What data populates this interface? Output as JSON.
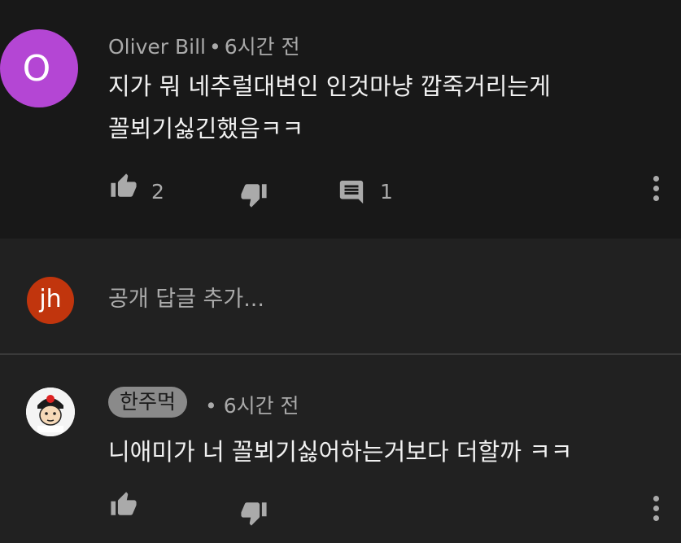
{
  "comments": [
    {
      "avatar_letter": "O",
      "avatar_color": "#b446d4",
      "author": "Oliver Bill",
      "separator": "•",
      "time": "6시간 전",
      "text_lines": [
        "지가 뭐 네추럴대변인 인것마냥 깝죽거리는게",
        "꼴뵈기싫긴했음ㅋㅋ"
      ],
      "like_count": "2",
      "reply_count": "1"
    },
    {
      "avatar_label": "한주먹TV",
      "author": "한주먹",
      "separator": "•",
      "time": "6시간 전",
      "text": "니애미가 너 꼴뵈기싫어하는거보다 더할까 ㅋㅋ"
    }
  ],
  "reply_box": {
    "avatar_text": "jh",
    "avatar_color": "#c1350d",
    "placeholder": "공개 답글 추가..."
  },
  "icons": [
    "thumbs-up-icon",
    "thumbs-down-icon",
    "comment-icon",
    "more-vert-icon"
  ]
}
